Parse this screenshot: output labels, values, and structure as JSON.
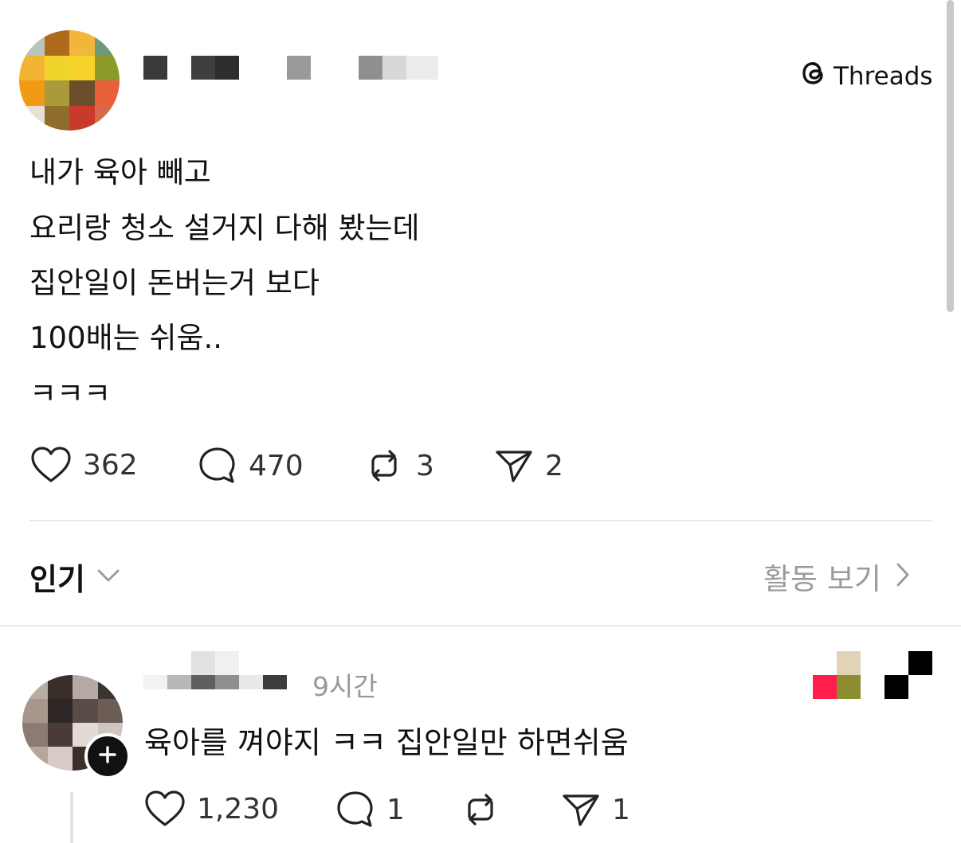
{
  "brand": {
    "name": "Threads"
  },
  "post": {
    "lines": [
      "내가 육아 빼고",
      "요리랑 청소 설거지 다해 봤는데",
      "집안일이 돈버는거 보다",
      "100배는 쉬움..",
      "ㅋㅋㅋ"
    ],
    "likes": "362",
    "comments": "470",
    "reposts": "3",
    "shares": "2"
  },
  "sort": {
    "label": "인기",
    "activity_label": "활동 보기"
  },
  "reply": {
    "time": "9시간",
    "text": "육아를 껴야지 ㅋㅋ 집안일만 하면쉬움",
    "likes": "1,230",
    "comments": "1",
    "shares": "1"
  },
  "icons": {
    "like": "heart-icon",
    "comment": "comment-bubble-icon",
    "repost": "repost-icon",
    "share": "send-icon",
    "brand": "threads-logo-icon",
    "chevron_down": "chevron-down-icon",
    "chevron_right": "chevron-right-icon",
    "follow": "plus-icon"
  }
}
